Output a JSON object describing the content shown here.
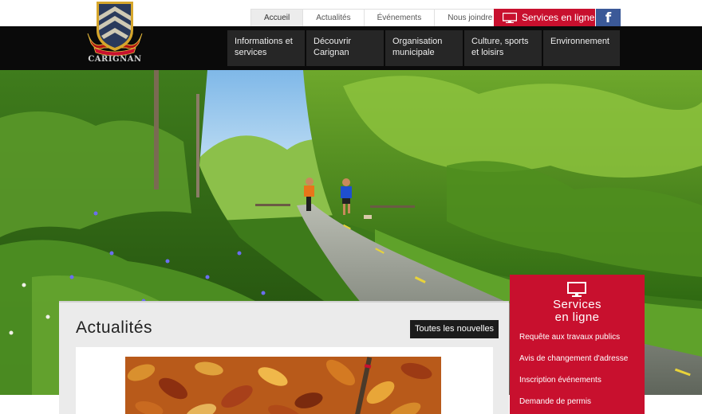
{
  "topnav": {
    "tabs": [
      {
        "label": "Accueil"
      },
      {
        "label": "Actualités"
      },
      {
        "label": "Événements"
      },
      {
        "label": "Nous joindre"
      }
    ],
    "online_label": "Services en ligne",
    "facebook_glyph": "f"
  },
  "logo": {
    "text": "CARIGNAN"
  },
  "mainnav": [
    {
      "line1": "Informations et",
      "line2": "services"
    },
    {
      "line1": "Découvrir",
      "line2": "Carignan"
    },
    {
      "line1": "Organisation",
      "line2": "municipale"
    },
    {
      "line1": "Culture, sports",
      "line2": "et loisirs"
    },
    {
      "line1": "Environnement",
      "line2": ""
    }
  ],
  "news": {
    "title": "Actualités",
    "all_label": "Toutes les nouvelles"
  },
  "services": {
    "title_line1": "Services",
    "title_line2": "en ligne",
    "links": [
      {
        "label": "Requête aux travaux publics"
      },
      {
        "label": "Avis de changement d'adresse"
      },
      {
        "label": "Inscription événements"
      },
      {
        "label": "Demande de permis"
      }
    ]
  },
  "colors": {
    "accent_red": "#c8102e",
    "facebook_blue": "#3b5998",
    "nav_black": "#0a0a0a"
  },
  "icons": {
    "monitor": "monitor-icon",
    "facebook": "facebook-icon",
    "crest": "city-crest-icon"
  }
}
